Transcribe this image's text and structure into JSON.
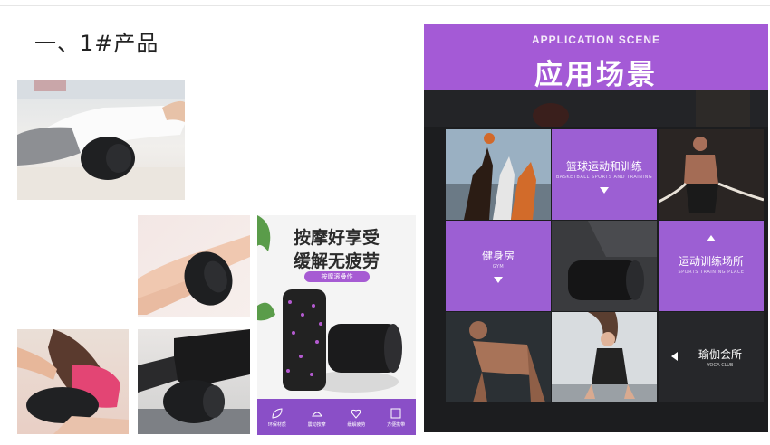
{
  "heading": "一、1#产品",
  "poster": {
    "line1": "按摩好享受",
    "line2": "缓解无疲劳",
    "pill": "按摩滚叠作",
    "features": [
      {
        "icon": "leaf-icon",
        "label": "环保材质"
      },
      {
        "icon": "massage-icon",
        "label": "震动按摩"
      },
      {
        "icon": "heart-icon",
        "label": "缓解疲劳"
      },
      {
        "icon": "frame-icon",
        "label": "方便携带"
      }
    ]
  },
  "panel": {
    "subtitle": "APPLICATION SCENE",
    "title": "应用场景",
    "scenes": [
      {
        "cn": "篮球运动和训练",
        "en": "BASKETBALL SPORTS AND TRAINING"
      },
      {
        "cn": "健身房",
        "en": "GYM"
      },
      {
        "cn": "运动训练场所",
        "en": "SPORTS TRAINING PLACE"
      },
      {
        "cn": "瑜伽会所",
        "en": "YOGA CLUB"
      }
    ]
  },
  "colors": {
    "accent": "#a45ad6",
    "tile": "#9c5fd3",
    "panel_bg": "#1c1d1f"
  }
}
